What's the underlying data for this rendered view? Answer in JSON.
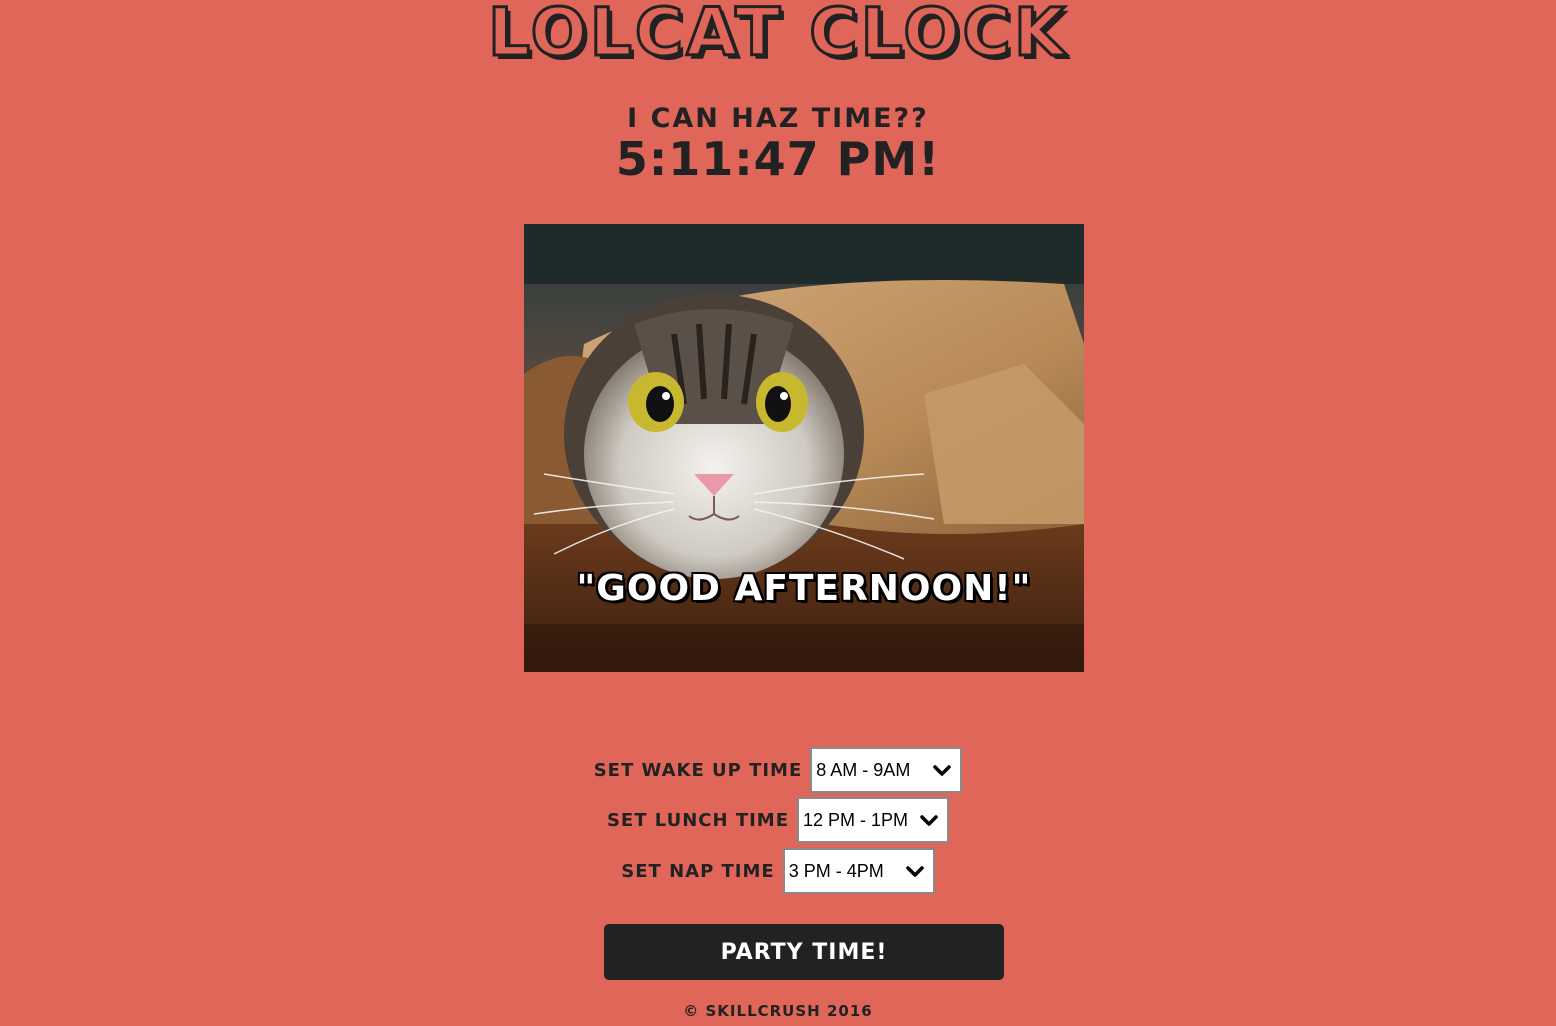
{
  "header": {
    "title": "LOLCAT CLOCK",
    "subtitle": "I CAN HAZ TIME??",
    "time": "5:11:47 PM!"
  },
  "image": {
    "caption": "\"GOOD AFTERNOON!\"",
    "subject": "cat-in-paper-roll"
  },
  "controls": {
    "wakeup_label": "SET WAKE UP TIME",
    "wakeup_value": "8 AM - 9AM",
    "lunch_label": "SET LUNCH TIME",
    "lunch_value": "12 PM - 1PM",
    "nap_label": "SET NAP TIME",
    "nap_value": "3 PM - 4PM",
    "party_button": "PARTY TIME!"
  },
  "footer": {
    "copyright": "© SKILLCRUSH 2016"
  },
  "colors": {
    "background": "#e0665a",
    "text_dark": "#222222",
    "button_bg": "#222222",
    "button_text": "#ffffff"
  }
}
